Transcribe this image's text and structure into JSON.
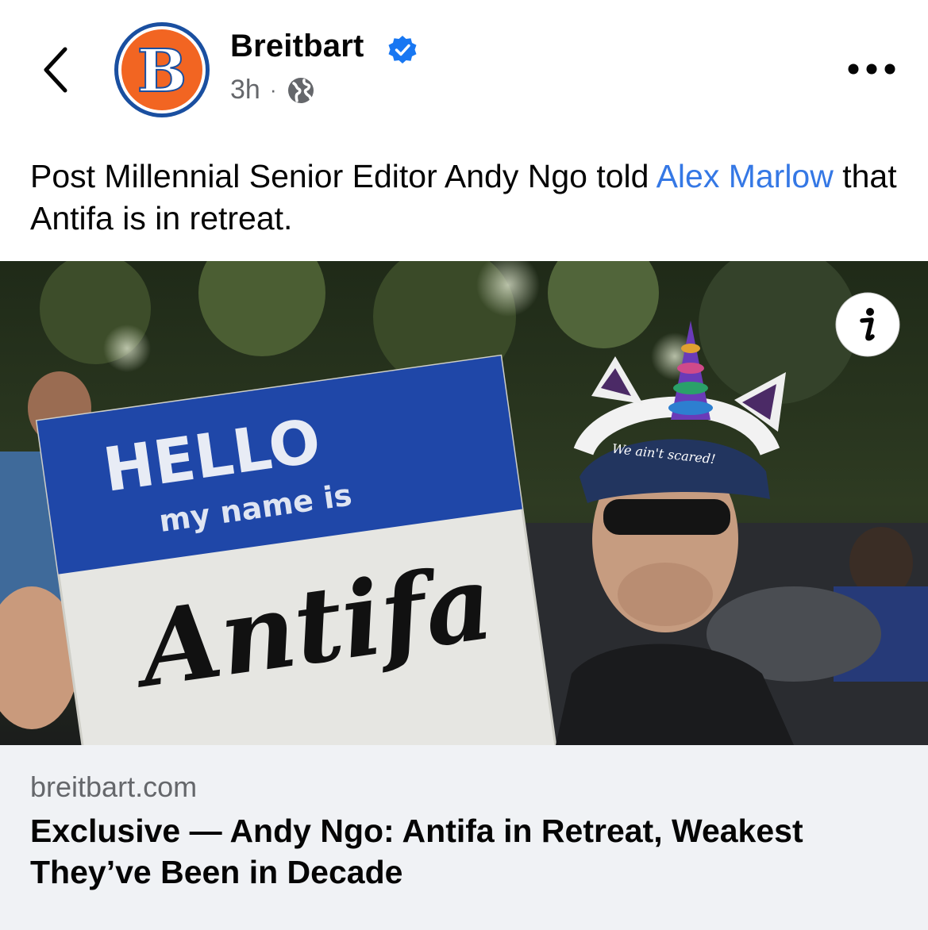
{
  "post": {
    "author": {
      "name": "Breitbart",
      "avatar_letter": "B",
      "verified_icon": "verified-badge-icon",
      "brand_color": "#f26522"
    },
    "timestamp": "3h",
    "separator": "·",
    "audience_icon": "globe-icon",
    "caption": {
      "before": "Post Millennial Senior Editor Andy Ngo told ",
      "mention": "Alex Marlow",
      "after": " that Antifa is in retreat."
    },
    "photo": {
      "sign_line1": "HELLO",
      "sign_line2": "my name is",
      "sign_name": "Antifa",
      "visor_text": "We ain't scared!",
      "info_icon": "info-icon"
    },
    "link": {
      "domain": "breitbart.com",
      "headline": "Exclusive — Andy Ngo: Antifa in Retreat, Weakest They’ve Been in Decade"
    }
  },
  "colors": {
    "link_blue": "#3578e5",
    "secondary_text": "#65676b",
    "card_bg": "#f0f2f5",
    "verified_blue": "#1877f2"
  }
}
